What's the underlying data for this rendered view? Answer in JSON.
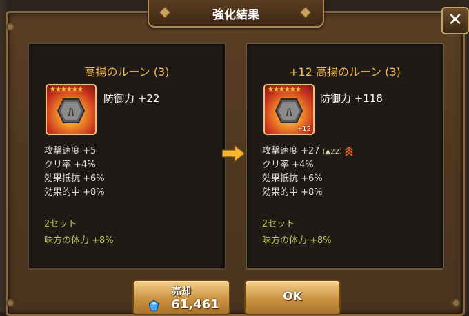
{
  "dialog": {
    "title": "強化結果",
    "close_label": "✕"
  },
  "before": {
    "rune_name": "高揚のルーン (3)",
    "stars": "★★★★★★",
    "rune_glyph": "ﾊ",
    "main_stat": "防御力 +22",
    "sub_stats": [
      "攻撃速度 +5",
      "クリ率 +4%",
      "効果抵抗 +6%",
      "効果的中 +8%"
    ],
    "set_label": "2セット",
    "set_effect": "味方の体力 +8%"
  },
  "after": {
    "rune_name": "+12 高揚のルーン (3)",
    "stars": "★★★★★★",
    "rune_glyph": "ﾊ",
    "level_badge": "+12",
    "main_stat": "防御力 +118",
    "sub_stats": [
      "攻撃速度 +27",
      "クリ率 +4%",
      "効果抵抗 +6%",
      "効果的中 +8%"
    ],
    "upgrade_note": "(▲22)",
    "set_label": "2セット",
    "set_effect": "味方の体力 +8%"
  },
  "buttons": {
    "sell_label": "売却",
    "sell_price": "61,461",
    "ok_label": "OK"
  },
  "colors": {
    "title_gold": "#f0b84a",
    "set_green": "#b6cc52",
    "arrow": "#f2b632"
  }
}
